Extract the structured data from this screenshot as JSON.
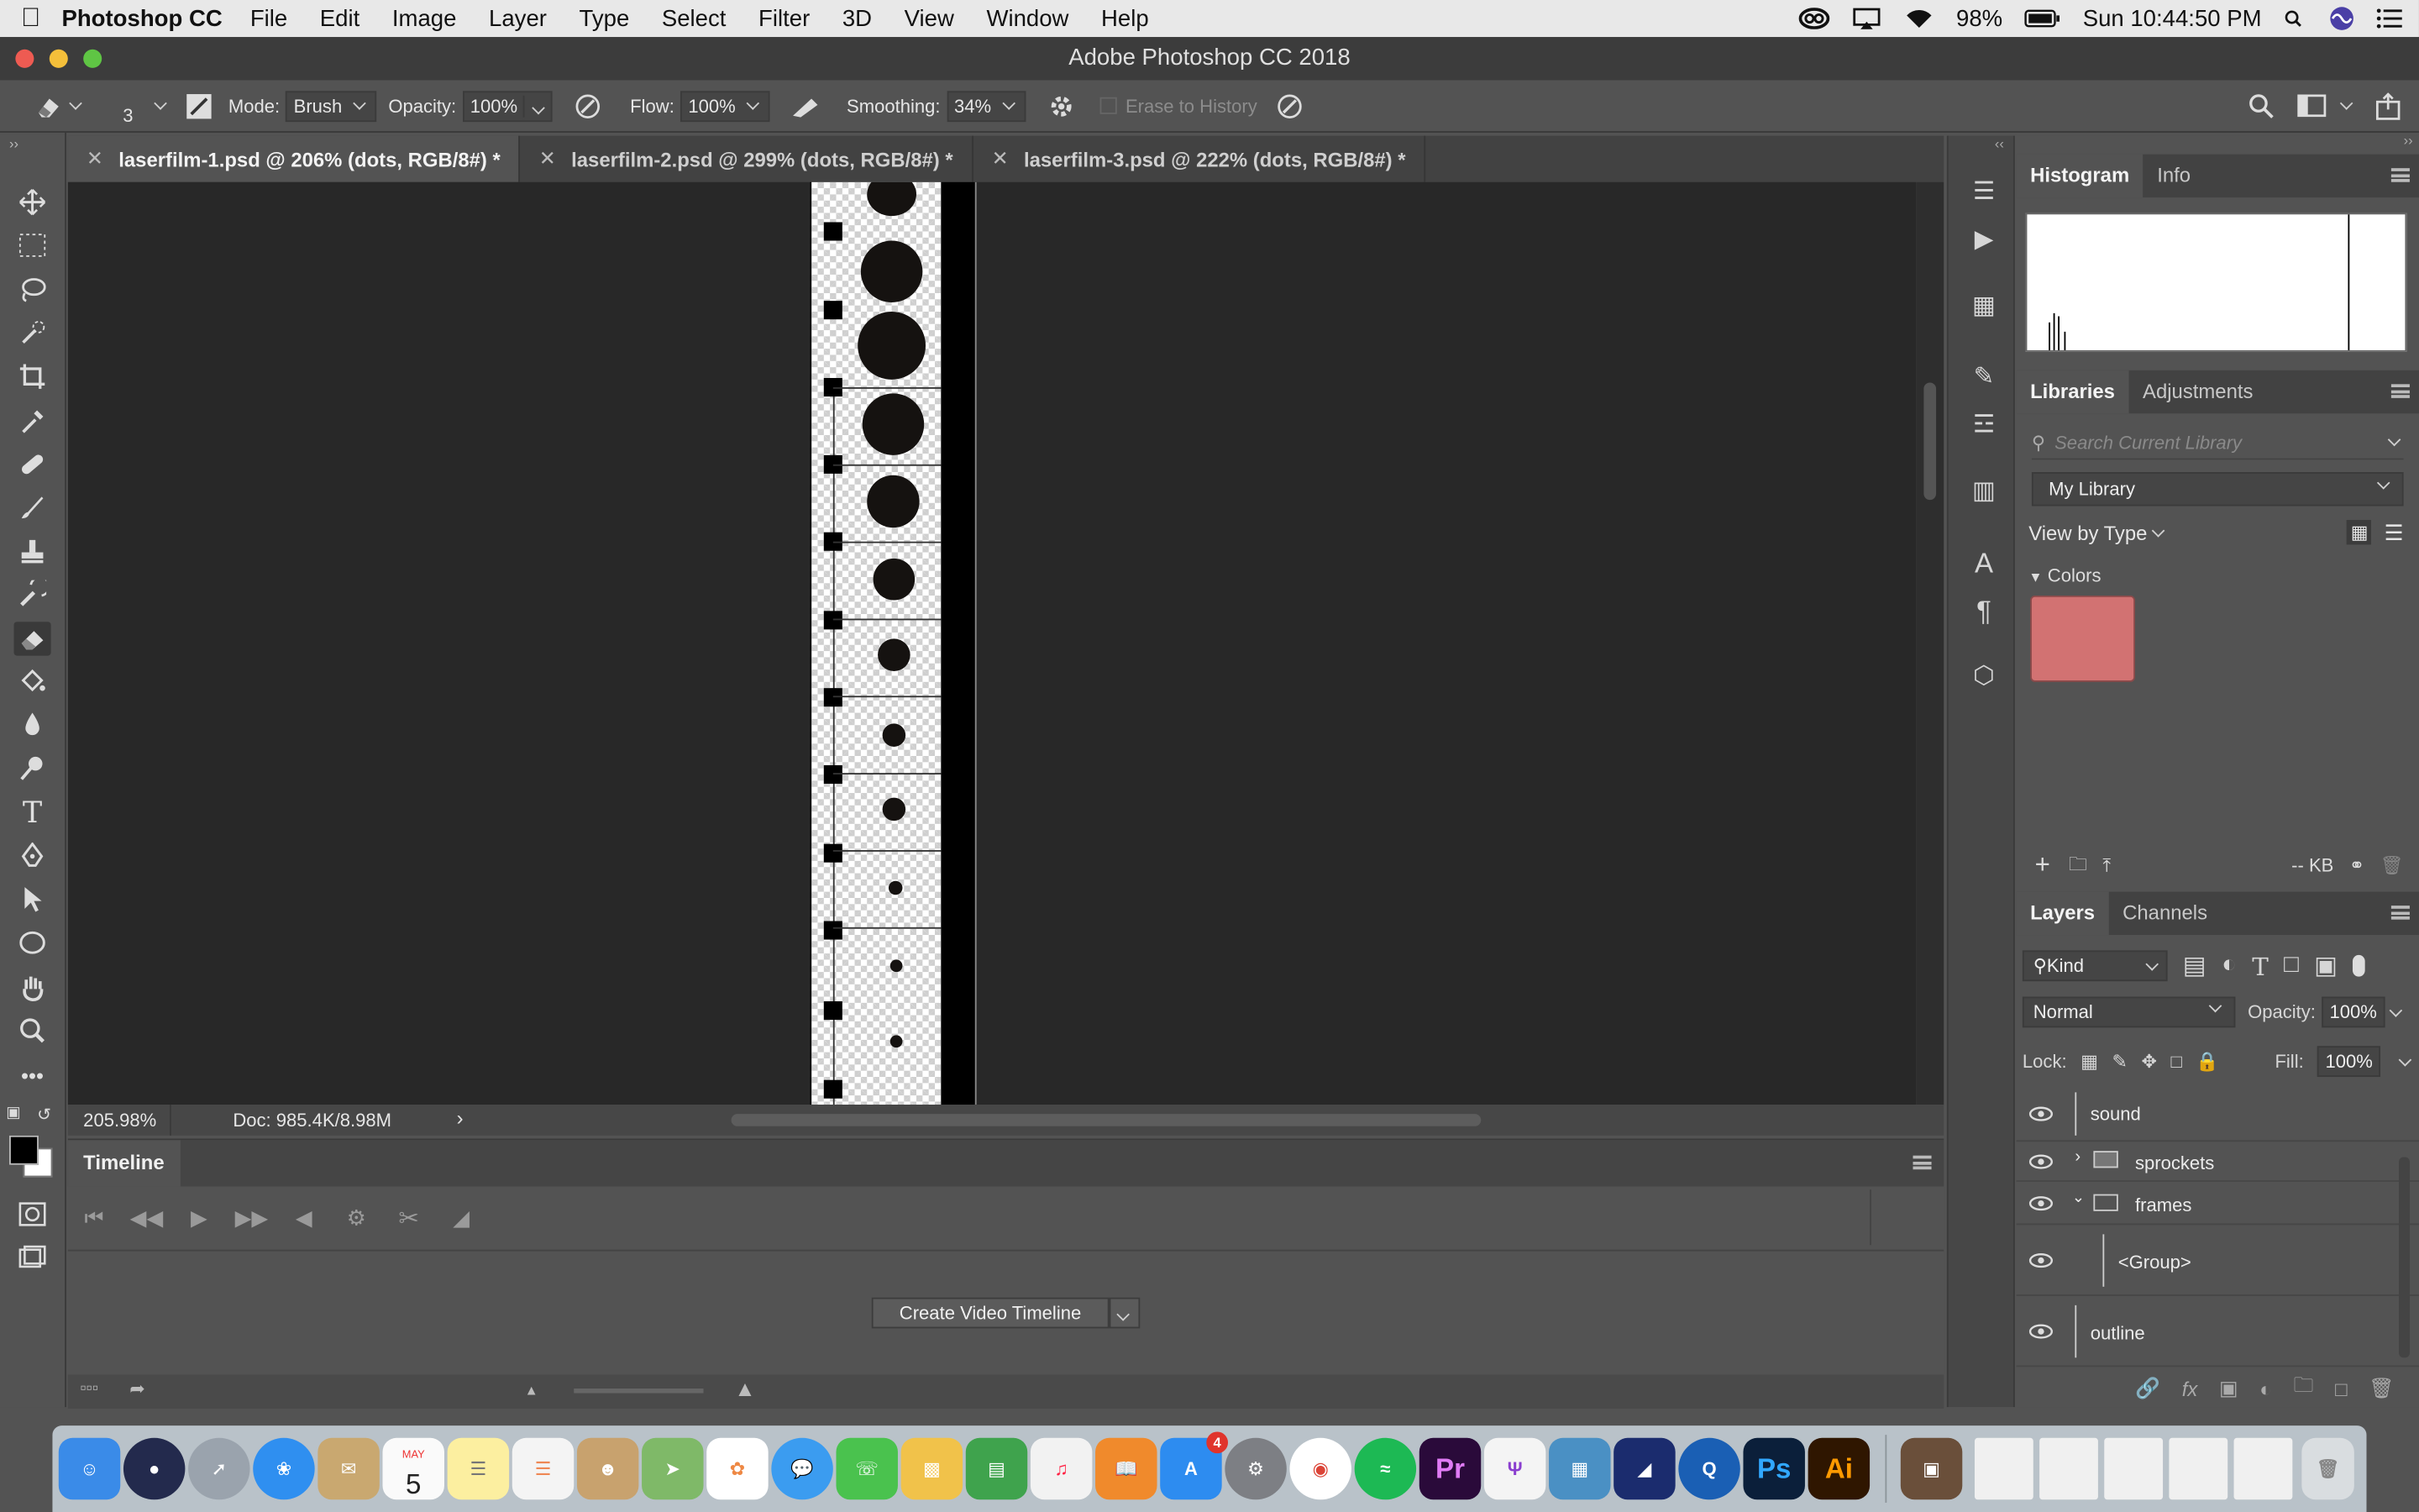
{
  "menubar": {
    "app_name": "Photoshop CC",
    "items": [
      "File",
      "Edit",
      "Image",
      "Layer",
      "Type",
      "Select",
      "Filter",
      "3D",
      "View",
      "Window",
      "Help"
    ],
    "battery": "98%",
    "clock": "Sun 10:44:50 PM"
  },
  "window": {
    "title": "Adobe Photoshop CC 2018"
  },
  "options": {
    "brush_size": "3",
    "mode_label": "Mode:",
    "mode_value": "Brush",
    "opacity_label": "Opacity:",
    "opacity_value": "100%",
    "flow_label": "Flow:",
    "flow_value": "100%",
    "smoothing_label": "Smoothing:",
    "smoothing_value": "34%",
    "erase_history_label": "Erase to History"
  },
  "doc_tabs": [
    {
      "label": "laserfilm-1.psd @ 206% (dots, RGB/8#) *",
      "active": true
    },
    {
      "label": "laserfilm-2.psd @ 299% (dots, RGB/8#) *",
      "active": false
    },
    {
      "label": "laserfilm-3.psd @ 222% (dots, RGB/8#) *",
      "active": false
    }
  ],
  "status": {
    "zoom": "205.98%",
    "doc": "Doc: 985.4K/8.98M"
  },
  "timeline": {
    "tab": "Timeline",
    "create_button": "Create Video Timeline"
  },
  "histogram_panel": {
    "tabs": [
      "Histogram",
      "Info"
    ]
  },
  "libraries_panel": {
    "tabs": [
      "Libraries",
      "Adjustments"
    ],
    "search_placeholder": "Search Current Library",
    "library": "My Library",
    "view_by": "View by Type",
    "colors_header": "Colors",
    "swatch_color": "#d27272",
    "size_label": "-- KB"
  },
  "layers_panel": {
    "tabs": [
      "Layers",
      "Channels"
    ],
    "kind": "Kind",
    "blend_mode": "Normal",
    "opacity_label": "Opacity:",
    "opacity_value": "100%",
    "lock_label": "Lock:",
    "fill_label": "Fill:",
    "fill_value": "100%",
    "layers": [
      {
        "name": "sound",
        "type": "layer"
      },
      {
        "name": "sprockets",
        "type": "group-collapsed"
      },
      {
        "name": "frames",
        "type": "group-expanded"
      },
      {
        "name": "<Group>",
        "type": "nested"
      },
      {
        "name": "outline",
        "type": "layer"
      }
    ]
  },
  "dock": {
    "calendar_month": "MAY",
    "calendar_day": "5",
    "appstore_badge": "4",
    "ps_label": "Ps",
    "ai_label": "Ai",
    "pr_label": "Pr"
  }
}
